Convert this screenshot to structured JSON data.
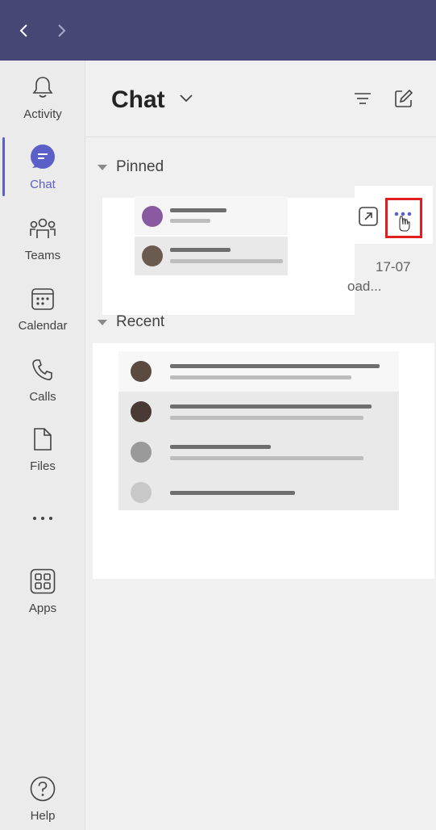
{
  "titlebar": {
    "back_icon": "chevron-left-icon",
    "forward_icon": "chevron-right-icon",
    "bg": "#464775"
  },
  "rail": {
    "items": [
      {
        "label": "Activity",
        "icon": "bell-icon"
      },
      {
        "label": "Chat",
        "icon": "chat-icon",
        "active": true
      },
      {
        "label": "Teams",
        "icon": "teams-icon"
      },
      {
        "label": "Calendar",
        "icon": "calendar-icon"
      },
      {
        "label": "Calls",
        "icon": "phone-icon"
      },
      {
        "label": "Files",
        "icon": "file-icon"
      },
      {
        "label": "",
        "icon": "more-apps-icon"
      },
      {
        "label": "Apps",
        "icon": "apps-icon"
      },
      {
        "label": "Help",
        "icon": "help-icon"
      }
    ],
    "accent": "#5b5fc7"
  },
  "chat": {
    "title": "Chat",
    "sections": {
      "pinned": "Pinned",
      "recent": "Recent"
    },
    "pinned_item": {
      "date": "17-07",
      "preview": "oad..."
    },
    "highlight_color": "#e02020"
  }
}
